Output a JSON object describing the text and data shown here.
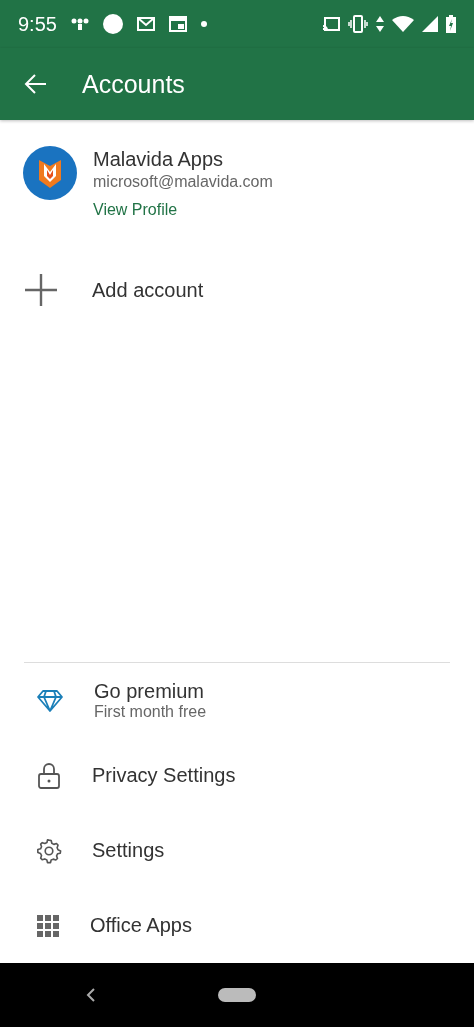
{
  "status_bar": {
    "time": "9:55"
  },
  "app_bar": {
    "title": "Accounts"
  },
  "account": {
    "name": "Malavida Apps",
    "email": "microsoft@malavida.com",
    "link": "View Profile"
  },
  "add_account": {
    "label": "Add account"
  },
  "menu": [
    {
      "kind": "premium",
      "label": "Go premium",
      "subtitle": "First month free"
    },
    {
      "kind": "privacy",
      "label": "Privacy Settings"
    },
    {
      "kind": "settings",
      "label": "Settings"
    },
    {
      "kind": "apps",
      "label": "Office Apps"
    }
  ]
}
